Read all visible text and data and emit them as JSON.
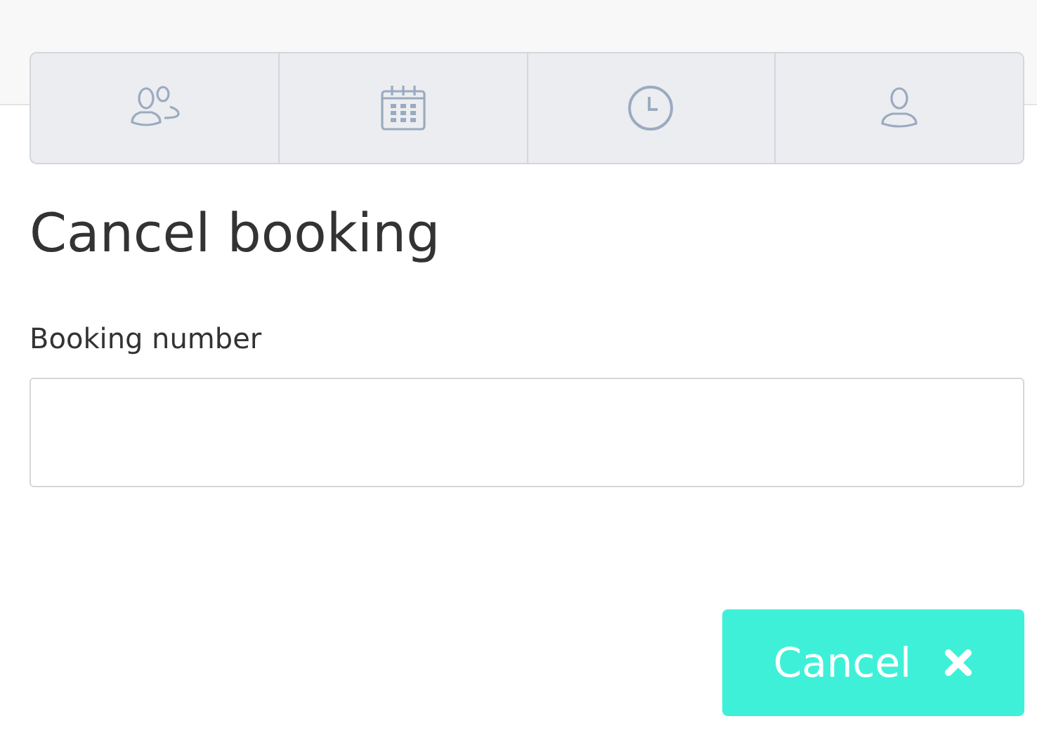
{
  "tabs": [
    {
      "kind": "users"
    },
    {
      "kind": "calendar"
    },
    {
      "kind": "clock"
    },
    {
      "kind": "user"
    }
  ],
  "title": "Cancel booking",
  "field": {
    "label": "Booking number"
  },
  "button": {
    "label": "Cancel"
  }
}
